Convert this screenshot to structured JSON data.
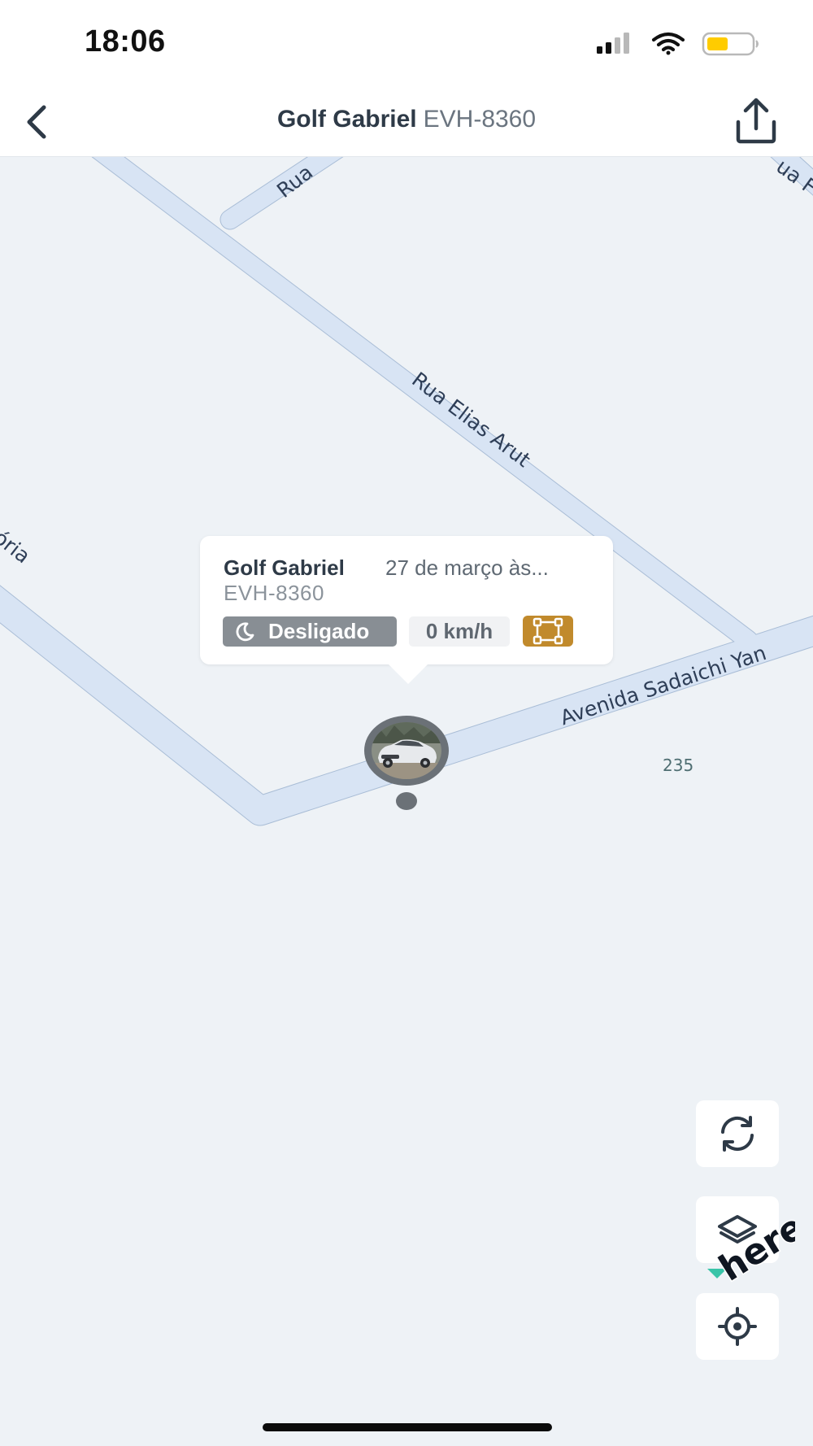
{
  "status_bar": {
    "time": "18:06",
    "signal_icon": "cellular-signal-icon",
    "wifi_icon": "wifi-icon",
    "battery_icon": "battery-icon",
    "battery_color": "#ffcc00"
  },
  "header": {
    "vehicle_name": "Golf Gabriel",
    "plate": "EVH-8360",
    "back_icon": "chevron-left-icon",
    "share_icon": "share-icon"
  },
  "map": {
    "streets": {
      "rua_top": "Rua",
      "rua_right": "ua F",
      "rua_elias": "Rua Elias Arut",
      "avenida": "Avenida Sadaichi Yan",
      "left": "ória"
    },
    "poi_number": "235",
    "road_color": "#d8e4f4",
    "background_color": "#eef2f6"
  },
  "callout": {
    "name": "Golf Gabriel",
    "timestamp": "27 de março às...",
    "plate": "EVH-8360",
    "status": "Desligado",
    "status_icon": "moon-icon",
    "speed": "0 km/h",
    "geofence_icon": "geofence-icon",
    "geofence_color": "#c18a2c"
  },
  "controls": {
    "refresh_icon": "refresh-icon",
    "layers_icon": "layers-icon",
    "locate_icon": "locate-icon"
  },
  "branding": {
    "logo_text": "here"
  }
}
